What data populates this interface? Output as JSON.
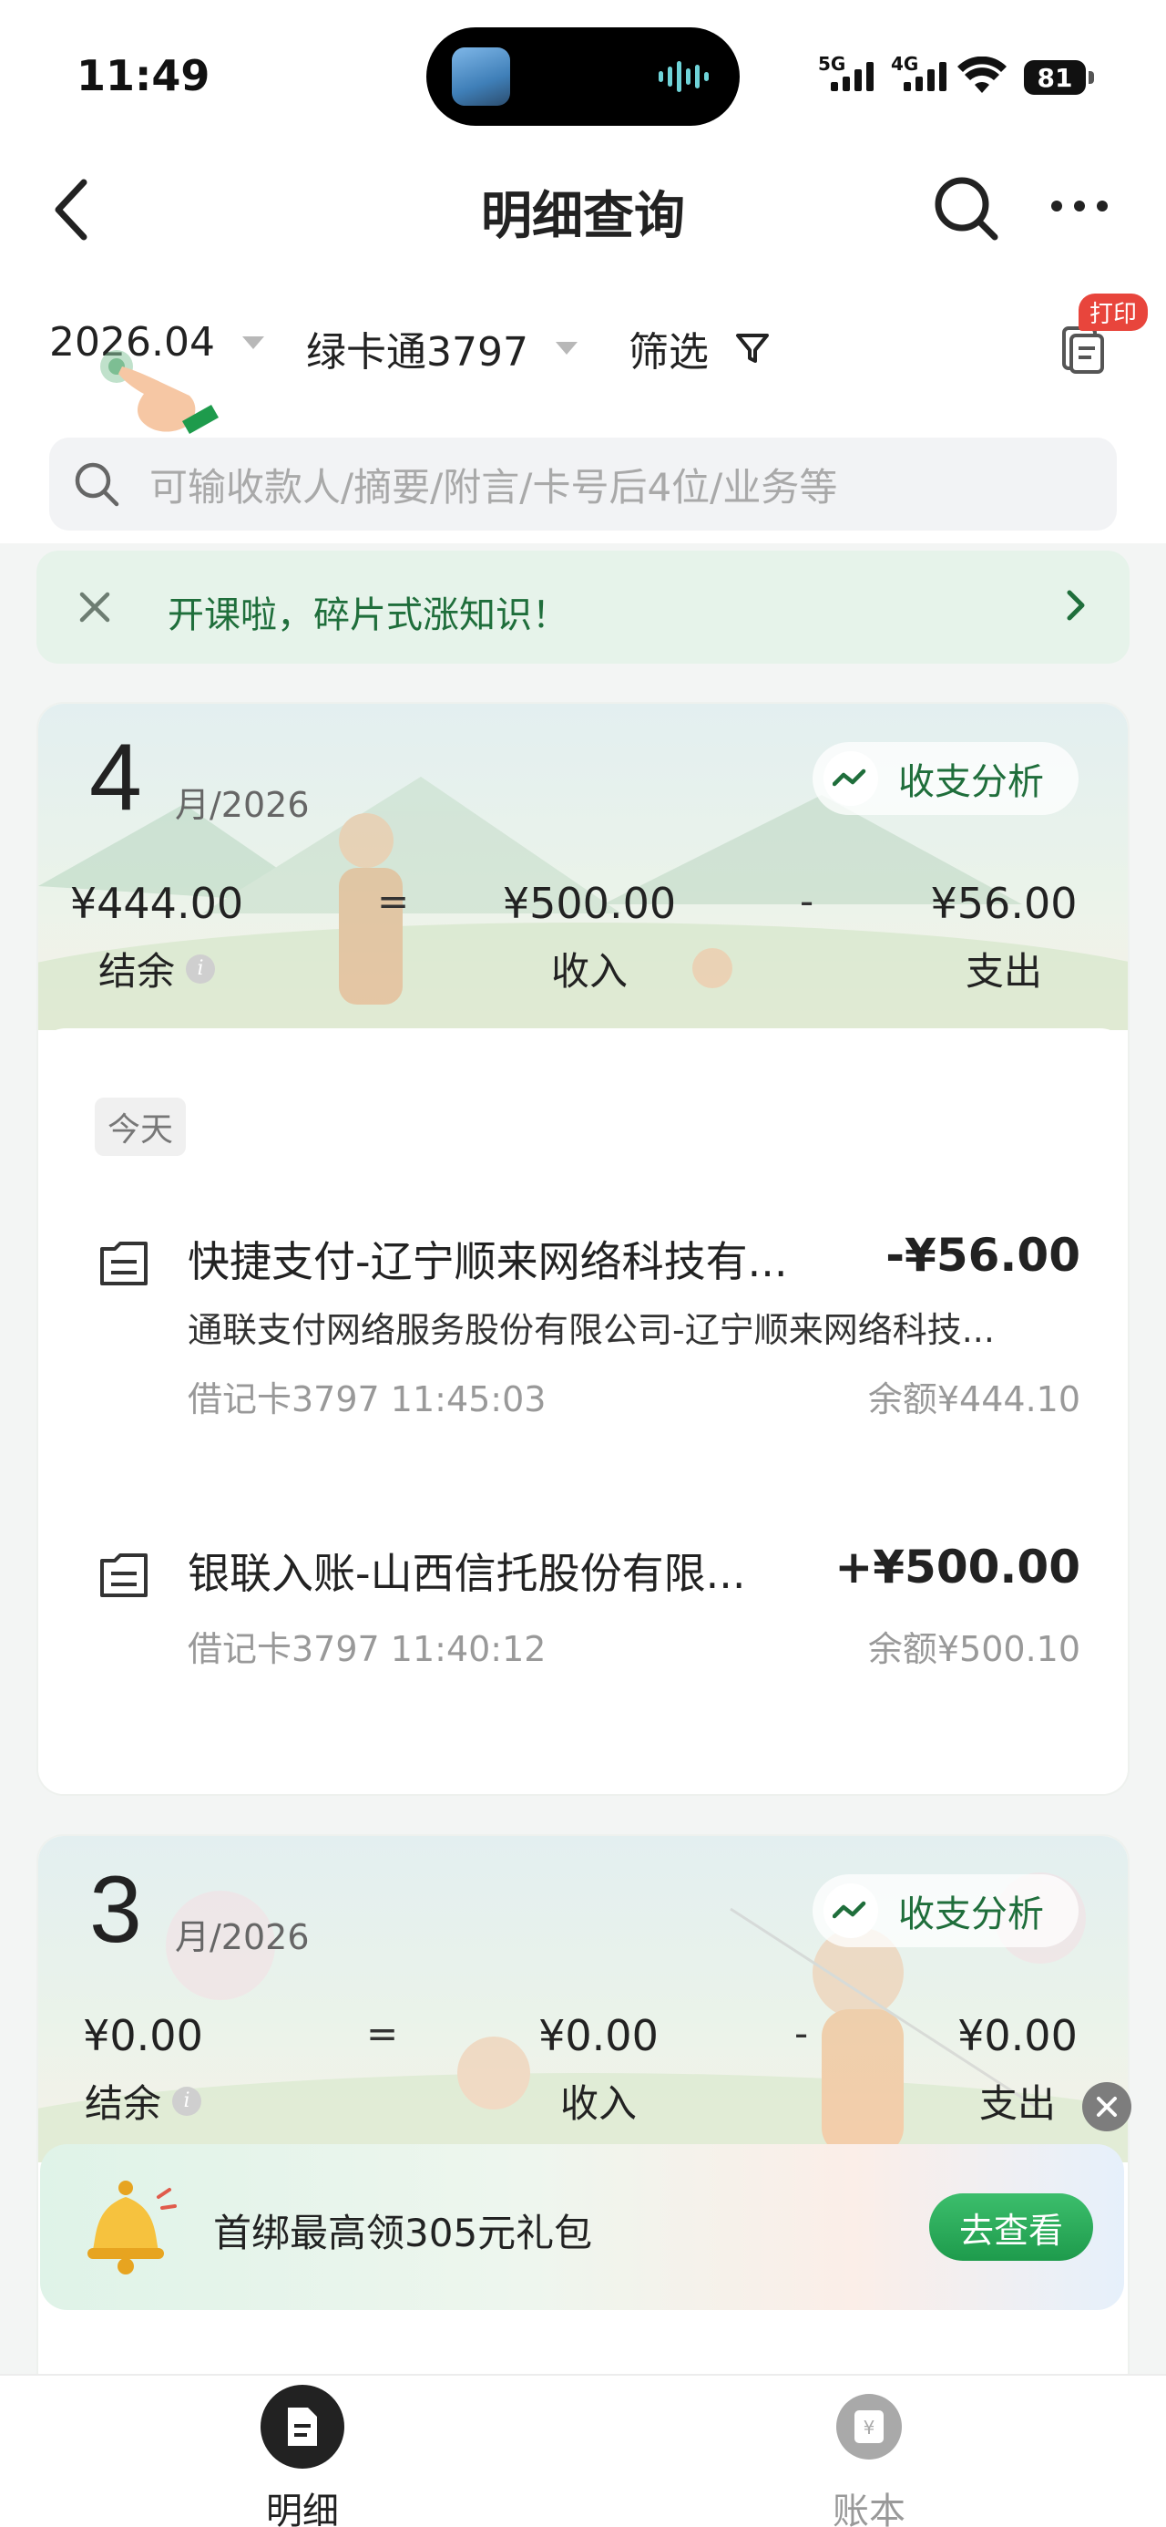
{
  "status": {
    "time": "11:49",
    "net1": "5G",
    "net2": "4G",
    "battery": "81"
  },
  "nav": {
    "title": "明细查询"
  },
  "filters": {
    "month": "2026.04",
    "card": "绿卡通3797",
    "filter_label": "筛选",
    "print_badge": "打印"
  },
  "search": {
    "placeholder": "可输收款人/摘要/附言/卡号后4位/业务等"
  },
  "banner": {
    "text": "开课啦，碎片式涨知识！"
  },
  "months": [
    {
      "month": "4",
      "year": "月/2026",
      "analysis_label": "收支分析",
      "balance": "¥444.00",
      "balance_label": "结余",
      "equals": "=",
      "income": "¥500.00",
      "income_label": "收入",
      "minus": "-",
      "expense": "¥56.00",
      "expense_label": "支出",
      "day_label": "今天",
      "transactions": [
        {
          "title": "快捷支付-辽宁顺来网络科技有...",
          "amount": "-¥56.00",
          "subtitle": "通联支付网络服务股份有限公司-辽宁顺来网络科技...",
          "meta": "借记卡3797 11:45:03",
          "balance": "余额¥444.10"
        },
        {
          "title": "银联入账-山西信托股份有限...",
          "amount": "+¥500.00",
          "meta": "借记卡3797 11:40:12",
          "balance": "余额¥500.10"
        }
      ]
    },
    {
      "month": "3",
      "year": "月/2026",
      "analysis_label": "收支分析",
      "balance": "¥0.00",
      "balance_label": "结余",
      "equals": "=",
      "income": "¥0.00",
      "income_label": "收入",
      "minus": "-",
      "expense": "¥0.00",
      "expense_label": "支出"
    }
  ],
  "promo": {
    "text": "首绑最高领305元礼包",
    "button": "去查看"
  },
  "tabbar": {
    "tabs": [
      {
        "label": "明细",
        "active": true
      },
      {
        "label": "账本",
        "active": false
      }
    ]
  },
  "colors": {
    "brand_green": "#1f6e3b",
    "button_green": "#2aae5a",
    "badge_red": "#e8453c"
  }
}
